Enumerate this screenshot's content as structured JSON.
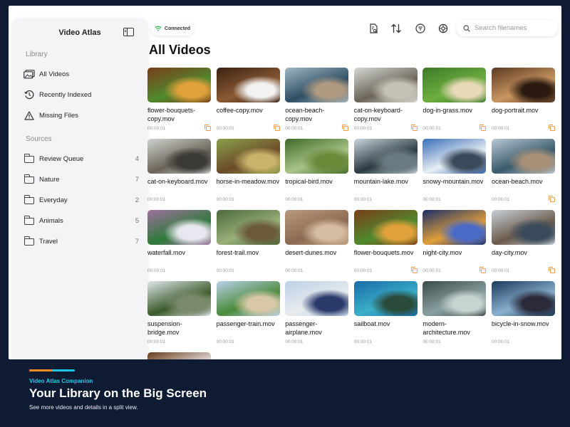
{
  "app": {
    "title": "Video Atlas"
  },
  "status": {
    "label": "Connected"
  },
  "sidebar": {
    "library_heading": "Library",
    "library_items": [
      {
        "label": "All Videos",
        "icon": "photos-icon"
      },
      {
        "label": "Recently Indexed",
        "icon": "clock-history-icon"
      },
      {
        "label": "Missing Files",
        "icon": "warning-icon"
      }
    ],
    "sources_heading": "Sources",
    "sources": [
      {
        "label": "Review Queue",
        "count": "4"
      },
      {
        "label": "Nature",
        "count": "7"
      },
      {
        "label": "Everyday",
        "count": "2"
      },
      {
        "label": "Animals",
        "count": "5"
      },
      {
        "label": "Travel",
        "count": "7"
      }
    ]
  },
  "toolbar": {
    "icons": [
      "report-search-icon",
      "sort-icon",
      "filter-icon",
      "settings-icon"
    ],
    "search_placeholder": "Search filenames"
  },
  "main": {
    "title": "All Videos"
  },
  "videos": [
    {
      "name": "flower-bouquets-copy.mov",
      "duration": "00:00:01",
      "colors": [
        "#7a3d1a",
        "#4f8a2e",
        "#e0a13a"
      ],
      "copy": true
    },
    {
      "name": "coffee-copy.mov",
      "duration": "00:00:01",
      "colors": [
        "#3c2212",
        "#8a5a34",
        "#f2f2f2"
      ],
      "copy": true
    },
    {
      "name": "ocean-beach-copy.mov",
      "duration": "00:00:01",
      "colors": [
        "#9fb7c6",
        "#2f4e62",
        "#b09a82"
      ],
      "copy": true
    },
    {
      "name": "cat-on-keyboard-copy.mov",
      "duration": "00:00:01",
      "colors": [
        "#d4d8d4",
        "#6b6458",
        "#c7c2b6"
      ],
      "copy": true
    },
    {
      "name": "dog-in-grass.mov",
      "duration": "00:00:01",
      "colors": [
        "#3d7a2a",
        "#6fae3f",
        "#e8d9b8"
      ],
      "copy": true
    },
    {
      "name": "dog-portrait.mov",
      "duration": "00:00:01",
      "colors": [
        "#5c3a22",
        "#c99660",
        "#2a1a10"
      ],
      "copy": true
    },
    {
      "name": "cat-on-keyboard.mov",
      "duration": "00:00:01",
      "colors": [
        "#cfd3cf",
        "#6b6458",
        "#3b3a36"
      ],
      "copy": false
    },
    {
      "name": "horse-in-meadow.mov",
      "duration": "00:00:01",
      "colors": [
        "#8aa04a",
        "#6b4a2a",
        "#c9b36a"
      ],
      "copy": false
    },
    {
      "name": "tropical-bird.mov",
      "duration": "00:00:01",
      "colors": [
        "#3f6a2a",
        "#a9c48a",
        "#6a8a3a"
      ],
      "copy": false
    },
    {
      "name": "mountain-lake.mov",
      "duration": "00:00:01",
      "colors": [
        "#c9d3dd",
        "#2a3a40",
        "#6a7a82"
      ],
      "copy": false
    },
    {
      "name": "snowy-mountain.mov",
      "duration": "00:00:01",
      "colors": [
        "#3a6fb8",
        "#e8eef4",
        "#3a4a5a"
      ],
      "copy": false
    },
    {
      "name": "ocean-beach.mov",
      "duration": "00:00:01",
      "colors": [
        "#b8c8d4",
        "#3a5a6a",
        "#a89078"
      ],
      "copy": true
    },
    {
      "name": "waterfall.mov",
      "duration": "00:00:01",
      "colors": [
        "#a070a0",
        "#2e7a3a",
        "#e8e8f0"
      ],
      "copy": false
    },
    {
      "name": "forest-trail.mov",
      "duration": "00:00:01",
      "colors": [
        "#4a6a3a",
        "#9ab07a",
        "#6a5a3a"
      ],
      "copy": false
    },
    {
      "name": "desert-dunes.mov",
      "duration": "00:00:01",
      "colors": [
        "#b89a7e",
        "#8a6a52",
        "#d6bca2"
      ],
      "copy": false
    },
    {
      "name": "flower-bouquets.mov",
      "duration": "00:00:01",
      "colors": [
        "#7a3d1a",
        "#4f8a2e",
        "#e0a13a"
      ],
      "copy": true
    },
    {
      "name": "night-city.mov",
      "duration": "00:00:01",
      "colors": [
        "#1a2e6a",
        "#e0a03a",
        "#4a6ac8"
      ],
      "copy": true
    },
    {
      "name": "day-city.mov",
      "duration": "00:00:01",
      "colors": [
        "#c8d0d8",
        "#6a5a4a",
        "#3a4a5a"
      ],
      "copy": true
    },
    {
      "name": "suspension-bridge.mov",
      "duration": "00:00:01",
      "colors": [
        "#dfe6ea",
        "#3a5a2a",
        "#7a8a6a"
      ],
      "copy": false
    },
    {
      "name": "passenger-train.mov",
      "duration": "00:00:01",
      "colors": [
        "#b8d0e8",
        "#4a8a3a",
        "#d8c8a8"
      ],
      "copy": false
    },
    {
      "name": "passenger-airplane.mov",
      "duration": "00:00:01",
      "colors": [
        "#bcd0e4",
        "#e8ecf0",
        "#2a3a6a"
      ],
      "copy": false
    },
    {
      "name": "sailboat.mov",
      "duration": "00:00:01",
      "colors": [
        "#1a6aa8",
        "#3ab0c8",
        "#2a4a3a"
      ],
      "copy": false
    },
    {
      "name": "modern-architecture.mov",
      "duration": "00:00:01",
      "colors": [
        "#3a4a4a",
        "#8aa0a0",
        "#c8d4d0"
      ],
      "copy": false
    },
    {
      "name": "bicycle-in-snow.mov",
      "duration": "00:00:01",
      "colors": [
        "#1a3a5a",
        "#8ab0d0",
        "#2a2a3a"
      ],
      "copy": false
    },
    {
      "name": "",
      "duration": "",
      "colors": [
        "#6a3a1a",
        "#f2f2f2",
        "#3c2212"
      ],
      "copy": false
    }
  ],
  "promo": {
    "label": "Video Atlas Companion",
    "title": "Your Library on the Big Screen",
    "subtitle": "See more videos and details in a split view."
  }
}
